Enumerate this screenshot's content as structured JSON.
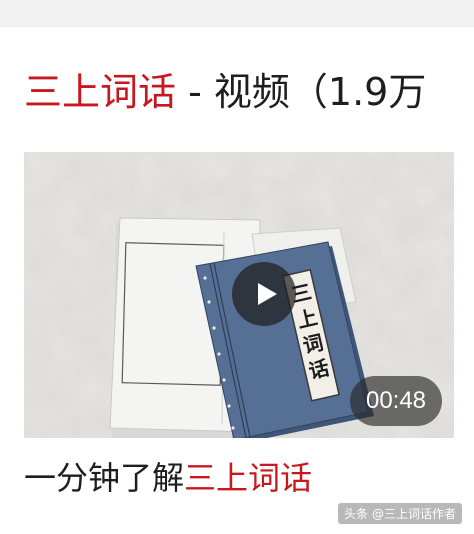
{
  "headline": {
    "highlight": "三上词话",
    "rest": " - 视频（1.9万"
  },
  "video": {
    "book_spine_label": "三上词话",
    "duration": "00:48"
  },
  "caption": {
    "prefix": "一分钟了解",
    "highlight": "三上词话"
  },
  "watermark": "头条 @三上词话作者",
  "colors": {
    "accent_red": "#c8171e",
    "text": "#1e1e1e",
    "book_cover": "#4a6288"
  },
  "icons": [
    "play-icon"
  ]
}
